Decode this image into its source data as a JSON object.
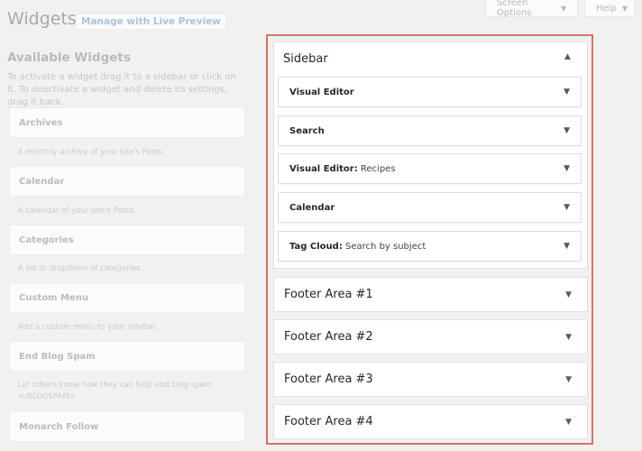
{
  "header": {
    "title": "Widgets",
    "live_preview": "Manage with Live Preview",
    "screen_options": "Screen Options",
    "help": "Help"
  },
  "available": {
    "title": "Available Widgets",
    "description": "To activate a widget drag it to a sidebar or click on it. To deactivate a widget and delete its settings, drag it back.",
    "widgets": [
      {
        "name": "Archives",
        "desc": "A monthly archive of your site's Posts."
      },
      {
        "name": "Calendar",
        "desc": "A calendar of your site's Posts."
      },
      {
        "name": "Categories",
        "desc": "A list or dropdown of categories."
      },
      {
        "name": "Custom Menu",
        "desc": "Add a custom menu to your sidebar."
      },
      {
        "name": "End Blog Spam",
        "desc": "Let others know how they can help end blog spam. </BLOGSPAM>"
      },
      {
        "name": "Monarch Follow",
        "desc": ""
      }
    ]
  },
  "sidebar": {
    "title": "Sidebar",
    "widgets": [
      {
        "name": "Visual Editor",
        "sub": ""
      },
      {
        "name": "Search",
        "sub": ""
      },
      {
        "name": "Visual Editor:",
        "sub": "Recipes"
      },
      {
        "name": "Calendar",
        "sub": ""
      },
      {
        "name": "Tag Cloud:",
        "sub": "Search by subject"
      }
    ]
  },
  "footer_areas": [
    {
      "label": "Footer Area #1"
    },
    {
      "label": "Footer Area #2"
    },
    {
      "label": "Footer Area #3"
    },
    {
      "label": "Footer Area #4"
    }
  ],
  "colors": {
    "highlight_border": "#d9735f",
    "background": "#f1f1f1"
  },
  "icons": {
    "caret_down": "▼",
    "caret_up": "▲"
  }
}
